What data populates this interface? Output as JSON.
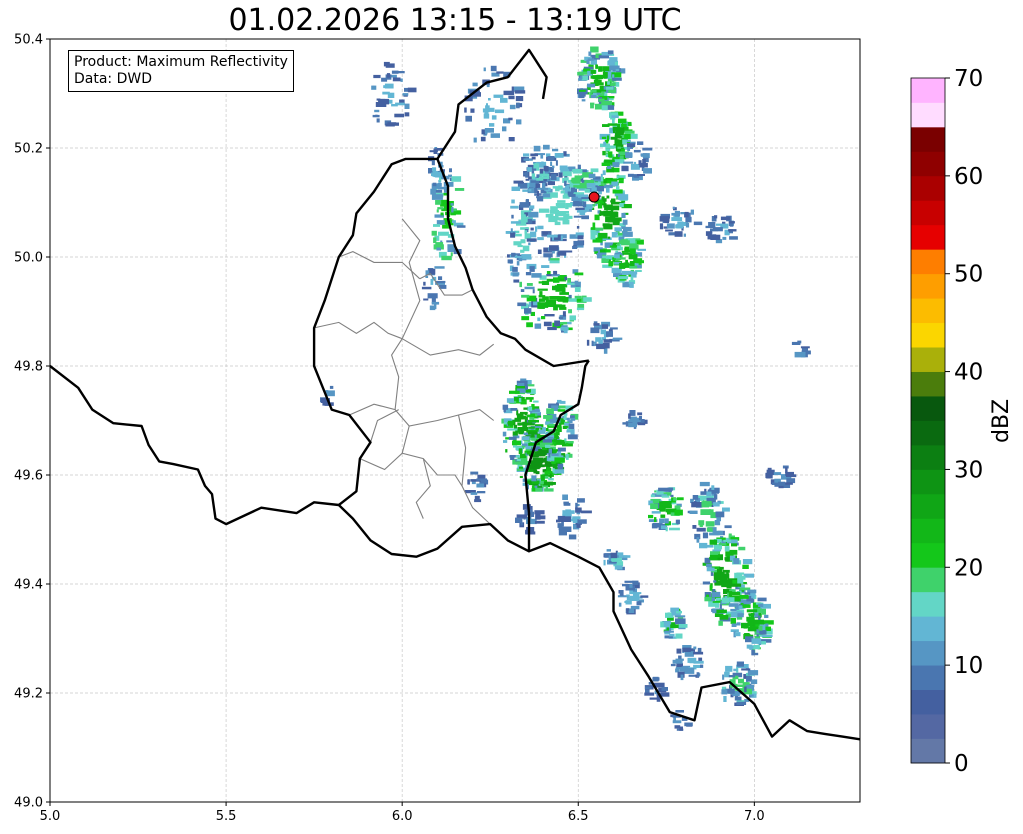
{
  "title": "01.02.2026 13:15 - 13:19 UTC",
  "info_box": {
    "product": "Product: Maximum Reflectivity",
    "data": "Data: DWD"
  },
  "axes": {
    "lon_range": [
      5.0,
      7.3
    ],
    "lat_range": [
      49.0,
      50.4
    ],
    "x_ticks": [
      {
        "v": 5.0,
        "label": "5.0"
      },
      {
        "v": 5.5,
        "label": "5.5"
      },
      {
        "v": 6.0,
        "label": "6.0"
      },
      {
        "v": 6.5,
        "label": "6.5"
      },
      {
        "v": 7.0,
        "label": "7.0"
      }
    ],
    "y_ticks": [
      {
        "v": 49.0,
        "label": "49.0"
      },
      {
        "v": 49.2,
        "label": "49.2"
      },
      {
        "v": 49.4,
        "label": "49.4"
      },
      {
        "v": 49.6,
        "label": "49.6"
      },
      {
        "v": 49.8,
        "label": "49.8"
      },
      {
        "v": 50.0,
        "label": "50.0"
      },
      {
        "v": 50.2,
        "label": "50.2"
      },
      {
        "v": 50.4,
        "label": "50.4"
      }
    ],
    "grid": true
  },
  "colorbar": {
    "label": "dBZ",
    "min": 0,
    "max": 70,
    "step": 2.5,
    "ticks": [
      {
        "v": 0,
        "label": "0"
      },
      {
        "v": 10,
        "label": "10"
      },
      {
        "v": 20,
        "label": "20"
      },
      {
        "v": 30,
        "label": "30"
      },
      {
        "v": 40,
        "label": "40"
      },
      {
        "v": 50,
        "label": "50"
      },
      {
        "v": 60,
        "label": "60"
      },
      {
        "v": 70,
        "label": "70"
      }
    ],
    "colors": [
      "#6378a7",
      "#5468a3",
      "#4460a0",
      "#4a76b0",
      "#5696c4",
      "#62b6d4",
      "#63d6c6",
      "#3fd26b",
      "#14c71a",
      "#12b718",
      "#10a616",
      "#0e9414",
      "#0c7f12",
      "#0a6a10",
      "#08580e",
      "#4b7d0c",
      "#aab00a",
      "#fbd600",
      "#fcbc00",
      "#fe9e00",
      "#fe7e00",
      "#e60000",
      "#c80000",
      "#aa0000",
      "#8f0000",
      "#7a0000",
      "#ffdcff",
      "#ffb4ff",
      "#ff78ff",
      "#ef3aef"
    ]
  },
  "marker": {
    "lon": 6.545,
    "lat": 50.11,
    "color": "#e8141e"
  },
  "colors": {
    "border": "#000000",
    "admin": "#808080",
    "grid": "#c8c8c8"
  },
  "outer_border": [
    [
      5.0,
      49.8
    ],
    [
      5.08,
      49.76
    ],
    [
      5.12,
      49.72
    ],
    [
      5.18,
      49.695
    ],
    [
      5.26,
      49.69
    ],
    [
      5.28,
      49.655
    ],
    [
      5.31,
      49.625
    ],
    [
      5.35,
      49.62
    ],
    [
      5.42,
      49.61
    ],
    [
      5.44,
      49.58
    ],
    [
      5.46,
      49.565
    ],
    [
      5.47,
      49.52
    ],
    [
      5.5,
      49.51
    ],
    [
      5.6,
      49.54
    ],
    [
      5.7,
      49.53
    ],
    [
      5.75,
      49.55
    ],
    [
      5.82,
      49.545
    ],
    [
      5.86,
      49.52
    ],
    [
      5.91,
      49.48
    ],
    [
      5.97,
      49.455
    ],
    [
      6.04,
      49.45
    ],
    [
      6.1,
      49.465
    ],
    [
      6.17,
      49.505
    ],
    [
      6.25,
      49.51
    ],
    [
      6.3,
      49.48
    ],
    [
      6.36,
      49.46
    ],
    [
      6.42,
      49.475
    ],
    [
      6.5,
      49.45
    ],
    [
      6.56,
      49.43
    ],
    [
      6.6,
      49.385
    ],
    [
      6.6,
      49.35
    ],
    [
      6.65,
      49.28
    ],
    [
      6.7,
      49.23
    ],
    [
      6.76,
      49.165
    ],
    [
      6.83,
      49.15
    ],
    [
      6.85,
      49.21
    ],
    [
      6.93,
      49.22
    ],
    [
      7.0,
      49.18
    ],
    [
      7.05,
      49.12
    ],
    [
      7.1,
      49.15
    ],
    [
      7.15,
      49.13
    ],
    [
      7.2,
      49.125
    ],
    [
      7.25,
      49.12
    ],
    [
      7.3,
      49.115
    ]
  ],
  "lux_de_border": [
    [
      6.53,
      49.81
    ],
    [
      6.43,
      49.8
    ],
    [
      6.35,
      49.83
    ],
    [
      6.32,
      49.85
    ],
    [
      6.28,
      49.86
    ],
    [
      6.24,
      49.89
    ],
    [
      6.2,
      49.94
    ],
    [
      6.18,
      49.98
    ],
    [
      6.15,
      50.02
    ],
    [
      6.13,
      50.07
    ],
    [
      6.13,
      50.13
    ],
    [
      6.1,
      50.18
    ],
    [
      6.01,
      50.18
    ],
    [
      5.97,
      50.17
    ],
    [
      5.92,
      50.12
    ],
    [
      5.87,
      50.08
    ],
    [
      5.86,
      50.04
    ],
    [
      5.82,
      50.0
    ],
    [
      5.78,
      49.92
    ],
    [
      5.75,
      49.87
    ],
    [
      5.75,
      49.8
    ],
    [
      5.8,
      49.72
    ],
    [
      5.85,
      49.71
    ],
    [
      5.91,
      49.66
    ],
    [
      5.88,
      49.63
    ],
    [
      5.87,
      49.57
    ],
    [
      5.83,
      49.55
    ],
    [
      5.82,
      49.545
    ]
  ],
  "de_fr_border": [
    [
      6.36,
      49.46
    ],
    [
      6.36,
      49.53
    ],
    [
      6.35,
      49.6
    ],
    [
      6.38,
      49.66
    ],
    [
      6.43,
      49.68
    ],
    [
      6.45,
      49.71
    ],
    [
      6.5,
      49.73
    ],
    [
      6.51,
      49.76
    ],
    [
      6.52,
      49.8
    ],
    [
      6.53,
      49.81
    ]
  ],
  "de_be_border": [
    [
      6.1,
      50.18
    ],
    [
      6.15,
      50.23
    ],
    [
      6.16,
      50.28
    ],
    [
      6.24,
      50.32
    ],
    [
      6.3,
      50.33
    ],
    [
      6.36,
      50.38
    ],
    [
      6.41,
      50.33
    ],
    [
      6.4,
      50.29
    ]
  ],
  "admin_lines": [
    [
      [
        5.82,
        50.0
      ],
      [
        5.86,
        50.01
      ],
      [
        5.92,
        49.99
      ],
      [
        6.0,
        49.99
      ],
      [
        6.05,
        49.96
      ]
    ],
    [
      [
        6.0,
        50.07
      ],
      [
        6.05,
        50.03
      ],
      [
        6.02,
        49.99
      ],
      [
        6.05,
        49.92
      ],
      [
        6.0,
        49.85
      ]
    ],
    [
      [
        5.75,
        49.87
      ],
      [
        5.82,
        49.88
      ],
      [
        5.87,
        49.86
      ],
      [
        5.92,
        49.88
      ],
      [
        5.96,
        49.86
      ],
      [
        6.0,
        49.85
      ]
    ],
    [
      [
        6.08,
        49.97
      ],
      [
        6.12,
        49.93
      ],
      [
        6.17,
        49.93
      ],
      [
        6.2,
        49.94
      ]
    ],
    [
      [
        6.0,
        49.85
      ],
      [
        6.08,
        49.82
      ],
      [
        6.16,
        49.83
      ],
      [
        6.22,
        49.82
      ],
      [
        6.26,
        49.84
      ]
    ],
    [
      [
        6.05,
        49.96
      ],
      [
        6.08,
        49.97
      ]
    ],
    [
      [
        5.85,
        49.71
      ],
      [
        5.92,
        49.73
      ],
      [
        5.98,
        49.72
      ],
      [
        6.02,
        49.69
      ],
      [
        6.1,
        49.7
      ],
      [
        6.16,
        49.71
      ],
      [
        6.22,
        49.72
      ],
      [
        6.26,
        49.7
      ]
    ],
    [
      [
        5.98,
        49.72
      ],
      [
        5.99,
        49.78
      ],
      [
        5.97,
        49.82
      ],
      [
        6.0,
        49.85
      ]
    ],
    [
      [
        6.16,
        49.71
      ],
      [
        6.18,
        49.65
      ],
      [
        6.17,
        49.58
      ],
      [
        6.2,
        49.54
      ],
      [
        6.25,
        49.51
      ]
    ],
    [
      [
        5.88,
        49.63
      ],
      [
        5.95,
        49.61
      ],
      [
        6.0,
        49.64
      ],
      [
        6.06,
        49.63
      ],
      [
        6.1,
        49.6
      ],
      [
        6.15,
        49.6
      ],
      [
        6.17,
        49.58
      ]
    ],
    [
      [
        6.02,
        49.69
      ],
      [
        6.0,
        49.64
      ]
    ],
    [
      [
        6.06,
        49.63
      ],
      [
        6.08,
        49.58
      ],
      [
        6.04,
        49.55
      ],
      [
        6.06,
        49.52
      ]
    ],
    [
      [
        5.91,
        49.66
      ],
      [
        5.93,
        49.7
      ],
      [
        5.99,
        49.72
      ]
    ]
  ]
}
